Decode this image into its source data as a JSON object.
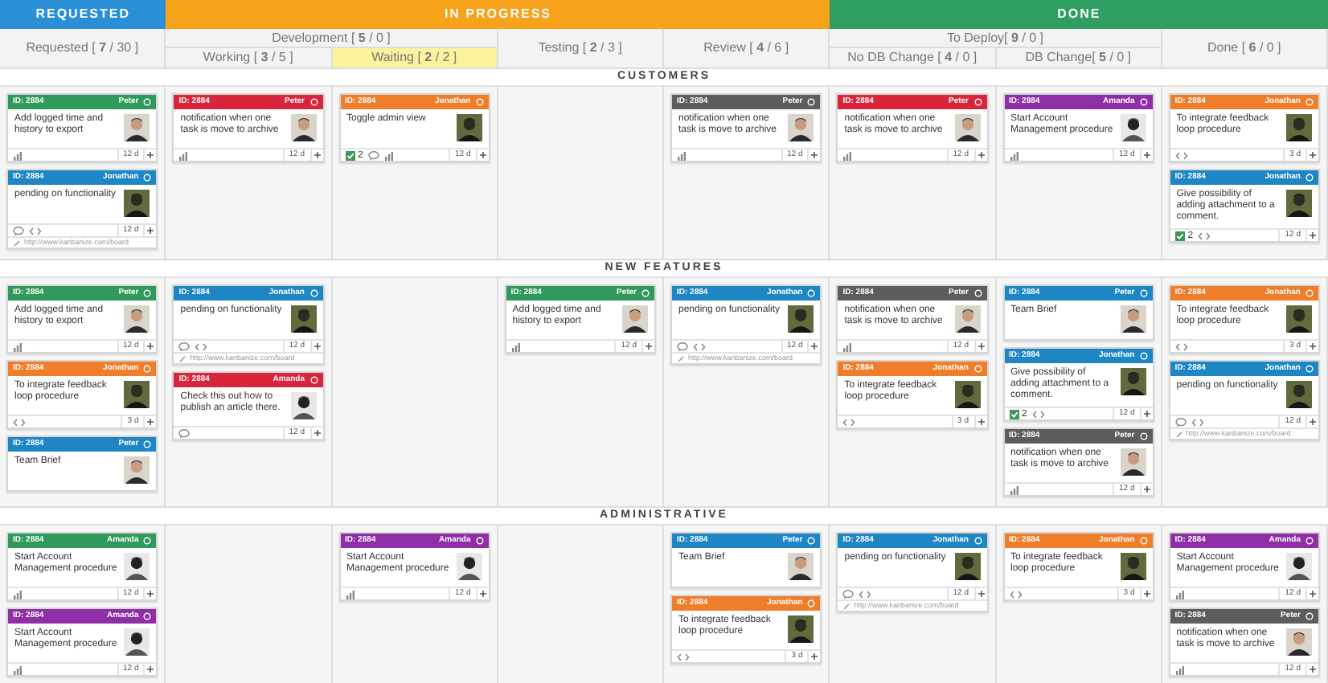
{
  "stages": [
    {
      "title": "REQUESTED",
      "color": "#2a8fd6",
      "columns": [
        {
          "label": "Requested [ **7** / 30 ]"
        }
      ]
    },
    {
      "title": "IN PROGRESS",
      "color": "#f7a21b",
      "columns": [
        {
          "label": "Development [ **5** / 0 ]",
          "children": [
            {
              "label": "Working [ **3** / 5 ]",
              "highlighted": false
            },
            {
              "label": "Waiting [ **2** / 2 ]",
              "highlighted": true
            }
          ]
        },
        {
          "label": "Testing [ **2** / 3 ]"
        },
        {
          "label": "Review [ **4** / 6 ]"
        }
      ]
    },
    {
      "title": "DONE",
      "color": "#2f9e63",
      "columns": [
        {
          "label": "To Deploy[ **9** / 0 ]",
          "children": [
            {
              "label": "No DB Change [ **4** / 0 ]",
              "highlighted": false
            },
            {
              "label": "DB Change[ **5** / 0 ]",
              "highlighted": false
            }
          ]
        },
        {
          "label": "Done [ **6** / 0 ]"
        }
      ]
    }
  ],
  "lanes": [
    {
      "title": "CUSTOMERS",
      "cells": [
        [
          {
            "id": "ID: 2884",
            "owner": "Peter",
            "color": "#2f9a5c",
            "text": "Add logged time and history to export",
            "avatar": {
              "kind": "light"
            },
            "footer": {
              "items": [
                {
                  "kind": "chart"
                }
              ],
              "estimate": "12 d"
            }
          },
          {
            "id": "ID: 2884",
            "owner": "Jonathan",
            "color": "#1f86c6",
            "text": "pending on functionality",
            "avatar": {
              "kind": "dark"
            },
            "footer": {
              "items": [
                {
                  "kind": "comment"
                },
                {
                  "kind": "code"
                }
              ],
              "estimate": "12 d"
            },
            "link": "http://www.kanbanize.com/board"
          }
        ],
        [
          {
            "id": "ID: 2884",
            "owner": "Peter",
            "color": "#d8253b",
            "text": "notification when one task is move to archive",
            "avatar": {
              "kind": "light"
            },
            "footer": {
              "items": [
                {
                  "kind": "chart"
                }
              ],
              "estimate": "12 d"
            }
          }
        ],
        [
          {
            "id": "ID: 2884",
            "owner": "Jonathan",
            "color": "#f07d2a",
            "text": "Toggle admin view",
            "avatar": {
              "kind": "dark"
            },
            "footer": {
              "items": [
                {
                  "kind": "subtasks",
                  "count": "2"
                },
                {
                  "kind": "comment"
                },
                {
                  "kind": "chart"
                }
              ],
              "estimate": "12 d"
            }
          }
        ],
        [],
        [
          {
            "id": "ID: 2884",
            "owner": "Peter",
            "color": "#5d5d5d",
            "text": "notification when one task is move to archive",
            "avatar": {
              "kind": "light"
            },
            "footer": {
              "items": [
                {
                  "kind": "chart"
                }
              ],
              "estimate": "12 d"
            }
          }
        ],
        [
          {
            "id": "ID: 2884",
            "owner": "Peter",
            "color": "#d8253b",
            "text": "notification when one task is move to archive",
            "avatar": {
              "kind": "light"
            },
            "footer": {
              "items": [
                {
                  "kind": "chart"
                }
              ],
              "estimate": "12 d"
            }
          }
        ],
        [
          {
            "id": "ID: 2884",
            "owner": "Amanda",
            "color": "#8e2fa5",
            "text": "Start Account Management procedure",
            "avatar": {
              "kind": "mono"
            },
            "footer": {
              "items": [
                {
                  "kind": "chart"
                }
              ],
              "estimate": "12 d"
            }
          }
        ],
        [
          {
            "id": "ID: 2884",
            "owner": "Jonathan",
            "color": "#f07d2a",
            "text": "To integrate feedback loop procedure",
            "avatar": {
              "kind": "dark"
            },
            "footer": {
              "items": [
                {
                  "kind": "code"
                }
              ],
              "estimate": "3 d"
            }
          },
          {
            "id": "ID: 2884",
            "owner": "Jonathan",
            "color": "#1f86c6",
            "text": "Give possibility of adding attachment to a comment.",
            "avatar": {
              "kind": "dark"
            },
            "footer": {
              "items": [
                {
                  "kind": "subtasks",
                  "count": "2"
                },
                {
                  "kind": "code"
                }
              ],
              "estimate": "12 d"
            }
          }
        ]
      ]
    },
    {
      "title": "NEW FEATURES",
      "cells": [
        [
          {
            "id": "ID: 2884",
            "owner": "Peter",
            "color": "#2f9a5c",
            "text": "Add logged time and history to export",
            "avatar": {
              "kind": "light"
            },
            "footer": {
              "items": [
                {
                  "kind": "chart"
                }
              ],
              "estimate": "12 d"
            }
          },
          {
            "id": "ID: 2884",
            "owner": "Jonathan",
            "color": "#f07d2a",
            "text": "To integrate feedback loop procedure",
            "avatar": {
              "kind": "dark"
            },
            "footer": {
              "items": [
                {
                  "kind": "code"
                }
              ],
              "estimate": "3 d"
            }
          },
          {
            "id": "ID: 2884",
            "owner": "Peter",
            "color": "#1f86c6",
            "text": "Team Brief",
            "avatar": {
              "kind": "light"
            }
          }
        ],
        [
          {
            "id": "ID: 2884",
            "owner": "Jonathan",
            "color": "#1f86c6",
            "text": "pending on functionality",
            "avatar": {
              "kind": "dark"
            },
            "footer": {
              "items": [
                {
                  "kind": "comment"
                },
                {
                  "kind": "code"
                }
              ],
              "estimate": "12 d"
            },
            "link": "http://www.kanbanize.com/board"
          },
          {
            "id": "ID: 2884",
            "owner": "Amanda",
            "color": "#d8253b",
            "text": "Check this out how to publish an article there.",
            "avatar": {
              "kind": "mono"
            },
            "footer": {
              "items": [
                {
                  "kind": "comment"
                }
              ],
              "estimate": "12 d"
            }
          }
        ],
        [],
        [
          {
            "id": "ID: 2884",
            "owner": "Peter",
            "color": "#2f9a5c",
            "text": "Add logged time and history to export",
            "avatar": {
              "kind": "light"
            },
            "footer": {
              "items": [
                {
                  "kind": "chart"
                }
              ],
              "estimate": "12 d"
            }
          }
        ],
        [
          {
            "id": "ID: 2884",
            "owner": "Jonathan",
            "color": "#1f86c6",
            "text": "pending on functionality",
            "avatar": {
              "kind": "dark"
            },
            "footer": {
              "items": [
                {
                  "kind": "comment"
                },
                {
                  "kind": "code"
                }
              ],
              "estimate": "12 d"
            },
            "link": "http://www.kanbanize.com/board"
          }
        ],
        [
          {
            "id": "ID: 2884",
            "owner": "Peter",
            "color": "#5d5d5d",
            "text": "notification when one task is move to archive",
            "avatar": {
              "kind": "light"
            },
            "footer": {
              "items": [
                {
                  "kind": "chart"
                }
              ],
              "estimate": "12 d"
            }
          },
          {
            "id": "ID: 2884",
            "owner": "Jonathan",
            "color": "#f07d2a",
            "text": "To integrate feedback loop procedure",
            "avatar": {
              "kind": "dark"
            },
            "footer": {
              "items": [
                {
                  "kind": "code"
                }
              ],
              "estimate": "3 d"
            }
          }
        ],
        [
          {
            "id": "ID: 2884",
            "owner": "Peter",
            "color": "#1f86c6",
            "text": "Team Brief",
            "avatar": {
              "kind": "light"
            }
          },
          {
            "id": "ID: 2884",
            "owner": "Jonathan",
            "color": "#1f86c6",
            "text": "Give possibility of adding attachment to a comment.",
            "avatar": {
              "kind": "dark"
            },
            "footer": {
              "items": [
                {
                  "kind": "subtasks",
                  "count": "2"
                },
                {
                  "kind": "code"
                }
              ],
              "estimate": "12 d"
            }
          },
          {
            "id": "ID: 2884",
            "owner": "Peter",
            "color": "#5d5d5d",
            "text": "notification when one task is move to archive",
            "avatar": {
              "kind": "light"
            },
            "footer": {
              "items": [
                {
                  "kind": "chart"
                }
              ],
              "estimate": "12 d"
            }
          }
        ],
        [
          {
            "id": "ID: 2884",
            "owner": "Jonathan",
            "color": "#f07d2a",
            "text": "To integrate feedback loop procedure",
            "avatar": {
              "kind": "dark"
            },
            "footer": {
              "items": [
                {
                  "kind": "code"
                }
              ],
              "estimate": "3 d"
            }
          },
          {
            "id": "ID: 2884",
            "owner": "Jonathan",
            "color": "#1f86c6",
            "text": "pending on functionality",
            "avatar": {
              "kind": "dark"
            },
            "footer": {
              "items": [
                {
                  "kind": "comment"
                },
                {
                  "kind": "code"
                }
              ],
              "estimate": "12 d"
            },
            "link": "http://www.kanbanize.com/board"
          }
        ]
      ]
    },
    {
      "title": "ADMINISTRATIVE",
      "cells": [
        [
          {
            "id": "ID: 2884",
            "owner": "Amanda",
            "color": "#2f9a5c",
            "text": "Start Account Management procedure",
            "avatar": {
              "kind": "mono"
            },
            "footer": {
              "items": [
                {
                  "kind": "chart"
                }
              ],
              "estimate": "12 d"
            }
          },
          {
            "id": "ID: 2884",
            "owner": "Amanda",
            "color": "#8e2fa5",
            "text": "Start Account Management procedure",
            "avatar": {
              "kind": "mono"
            },
            "footer": {
              "items": [
                {
                  "kind": "chart"
                }
              ],
              "estimate": "12 d"
            }
          }
        ],
        [],
        [
          {
            "id": "ID: 2884",
            "owner": "Amanda",
            "color": "#8e2fa5",
            "text": "Start Account Management procedure",
            "avatar": {
              "kind": "mono"
            },
            "footer": {
              "items": [
                {
                  "kind": "chart"
                }
              ],
              "estimate": "12 d"
            }
          }
        ],
        [],
        [
          {
            "id": "ID: 2884",
            "owner": "Peter",
            "color": "#1f86c6",
            "text": "Team Brief",
            "avatar": {
              "kind": "light"
            }
          },
          {
            "id": "ID: 2884",
            "owner": "Jonathan",
            "color": "#f07d2a",
            "text": "To integrate feedback loop procedure",
            "avatar": {
              "kind": "dark"
            },
            "footer": {
              "items": [
                {
                  "kind": "code"
                }
              ],
              "estimate": "3 d"
            }
          }
        ],
        [
          {
            "id": "ID: 2884",
            "owner": "Jonathan",
            "color": "#1f86c6",
            "text": "pending on functionality",
            "avatar": {
              "kind": "dark"
            },
            "footer": {
              "items": [
                {
                  "kind": "comment"
                },
                {
                  "kind": "code"
                }
              ],
              "estimate": "12 d"
            },
            "link": "http://www.kanbanize.com/board"
          }
        ],
        [
          {
            "id": "ID: 2884",
            "owner": "Jonathan",
            "color": "#f07d2a",
            "text": "To integrate feedback loop procedure",
            "avatar": {
              "kind": "dark"
            },
            "footer": {
              "items": [
                {
                  "kind": "code"
                }
              ],
              "estimate": "3 d"
            }
          }
        ],
        [
          {
            "id": "ID: 2884",
            "owner": "Amanda",
            "color": "#8e2fa5",
            "text": "Start Account Management procedure",
            "avatar": {
              "kind": "mono"
            },
            "footer": {
              "items": [
                {
                  "kind": "chart"
                }
              ],
              "estimate": "12 d"
            }
          },
          {
            "id": "ID: 2884",
            "owner": "Peter",
            "color": "#5d5d5d",
            "text": "notification when one task is move to archive",
            "avatar": {
              "kind": "light"
            },
            "footer": {
              "items": [
                {
                  "kind": "chart"
                }
              ],
              "estimate": "12 d"
            }
          }
        ]
      ]
    }
  ]
}
